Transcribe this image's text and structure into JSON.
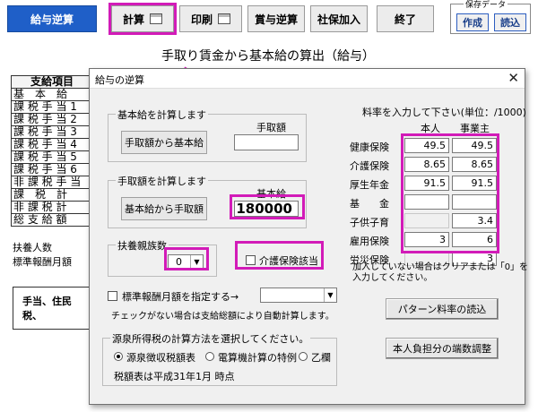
{
  "toolbar": {
    "salary_reverse": "給与逆算",
    "calculate": "計算",
    "print": "印刷",
    "bonus_reverse": "賞与逆算",
    "social_insurance": "社保加入",
    "exit": "終了",
    "save_data_title": "保存データ",
    "create": "作成",
    "read": "読込"
  },
  "heading": "手取り賃金から基本給の算出（給与）",
  "sheet": {
    "header": "支給項目",
    "rows": [
      "基　本　給",
      "課 税 手 当 1",
      "課 税 手 当 2",
      "課 税 手 当 3",
      "課 税 手 当 4",
      "課 税 手 当 5",
      "課 税 手 当 6",
      "非 課 税 手 当",
      "課　税　計",
      "非 課 税 計",
      "総 支 給 額"
    ],
    "dependents_label": "扶養人数",
    "standard_monthly_label": "標準報酬月額",
    "allowance_note": "手当、住民税、"
  },
  "dialog": {
    "title": "給与の逆算",
    "close_icon": "close-icon",
    "base_calc": {
      "group_label": "基本給を計算します",
      "takehome_label": "手取額",
      "button": "手取額から基本給",
      "takehome_value": ""
    },
    "takehome_calc": {
      "group_label": "手取額を計算します",
      "base_label": "基本給",
      "button": "基本給から手取額",
      "base_value": "180000"
    },
    "dependents": {
      "group_label": "扶養親族数",
      "value": "0"
    },
    "nursing": {
      "label": "介護保険該当",
      "checked": false
    },
    "standard_monthly": {
      "label": "標準報酬月額を指定する→",
      "value": "",
      "note": "チェックがない場合は支給総額により自動計算します。"
    },
    "withholding": {
      "group_label": "源泉所得税の計算方法を選択してください。",
      "options": [
        "源泉徴収税額表",
        "電算機計算の特例",
        "乙欄"
      ],
      "selected": 0,
      "note": "税額表は平成31年1月 時点"
    },
    "rates": {
      "header": "料率を入力して下さい(単位：/1000)",
      "col_self": "本人",
      "col_employer": "事業主",
      "rows": [
        {
          "name": "健康保険",
          "self": "49.5",
          "employer": "49.5",
          "self_disabled": false
        },
        {
          "name": "介護保険",
          "self": "8.65",
          "employer": "8.65",
          "self_disabled": false
        },
        {
          "name": "厚生年金",
          "self": "91.5",
          "employer": "91.5",
          "self_disabled": false
        },
        {
          "name": "基　　金",
          "self": "",
          "employer": "",
          "self_disabled": false
        },
        {
          "name": "子供子育",
          "self": "",
          "employer": "3.4",
          "self_disabled": true
        },
        {
          "name": "雇用保険",
          "self": "3",
          "employer": "6",
          "self_disabled": false
        },
        {
          "name": "労災保険",
          "self": "",
          "employer": "3",
          "self_disabled": true
        }
      ],
      "note_line1": "加入していない場合はクリアまたは「0」を",
      "note_line2": "入力してください。"
    },
    "pattern_button": "パターン料率の読込",
    "rounding_button": "本人負担分の端数調整"
  },
  "colors": {
    "highlight": "#d21bb8",
    "primary_button": "#1f5fc8"
  }
}
